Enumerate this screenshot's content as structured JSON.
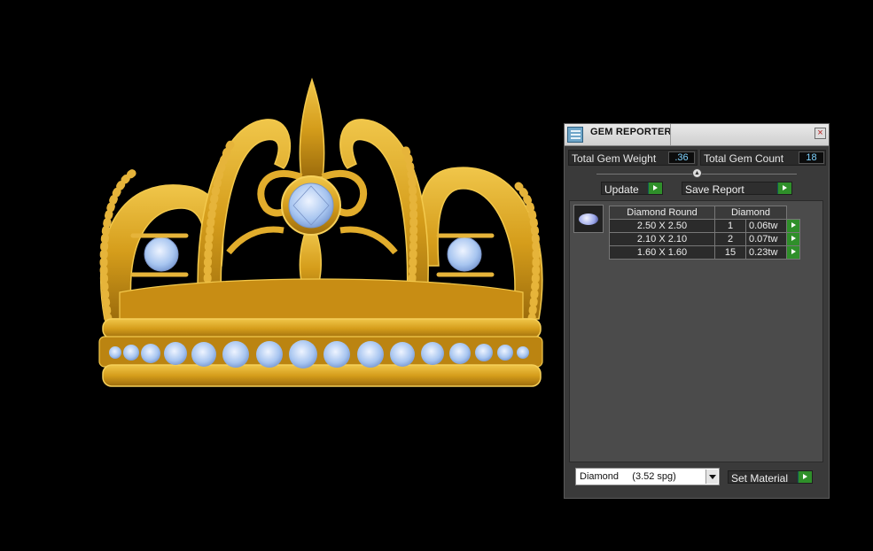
{
  "panel": {
    "title": "GEM REPORTER",
    "close_symbol": "×",
    "total_weight_label": "Total Gem Weight",
    "total_weight_value": ".36",
    "total_count_label": "Total Gem Count",
    "total_count_value": "18",
    "update_label": "Update",
    "save_report_label": "Save Report",
    "table": {
      "headers": [
        "Diamond Round",
        "Diamond"
      ],
      "rows": [
        {
          "size": "2.50 X 2.50",
          "count": "1",
          "weight": "0.06tw"
        },
        {
          "size": "2.10 X 2.10",
          "count": "2",
          "weight": "0.07tw"
        },
        {
          "size": "1.60 X 1.60",
          "count": "15",
          "weight": "0.23tw"
        }
      ]
    },
    "material_select": "Diamond     (3.52 spg)",
    "set_material_label": "Set Material"
  },
  "colors": {
    "gold": "#d9a21c",
    "gem": "#a9c9f2",
    "panel_bg": "#3a3a3a",
    "go_green": "#2f8f2a"
  },
  "icons": [
    "gem-reporter-icon",
    "close-icon",
    "slider-knob-icon",
    "go-arrow-icon",
    "gem-thumbnail-icon",
    "dropdown-arrow-icon"
  ]
}
